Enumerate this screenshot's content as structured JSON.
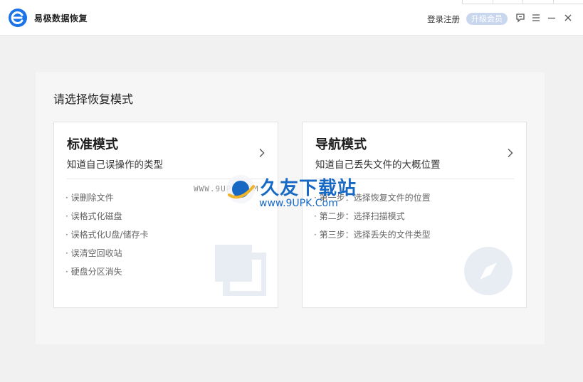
{
  "app": {
    "title": "易极数据恢复"
  },
  "header": {
    "login": "登录注册",
    "vip": "升级会员"
  },
  "main": {
    "prompt": "请选择恢复模式",
    "standard": {
      "title": "标准模式",
      "subtitle": "知道自己误操作的类型",
      "items": [
        "· 误删除文件",
        "· 误格式化磁盘",
        "· 误格式化U盘/储存卡",
        "· 误清空回收站",
        "· 硬盘分区消失"
      ]
    },
    "guide": {
      "title": "导航模式",
      "subtitle": "知道自己丢失文件的大概位置",
      "items": [
        "· 第一步：选择恢复文件的位置",
        "· 第二步：选择扫描模式",
        "· 第三步：选择丢失的文件类型"
      ]
    }
  },
  "watermark": {
    "name": "久友下载站",
    "url": "WWW.9UPK.COM",
    "url2": "www.9UPK.Com"
  },
  "colors": {
    "accent": "#1a73e8",
    "vip": "#c9d7ee",
    "icon_deco": "#e8edf3"
  }
}
